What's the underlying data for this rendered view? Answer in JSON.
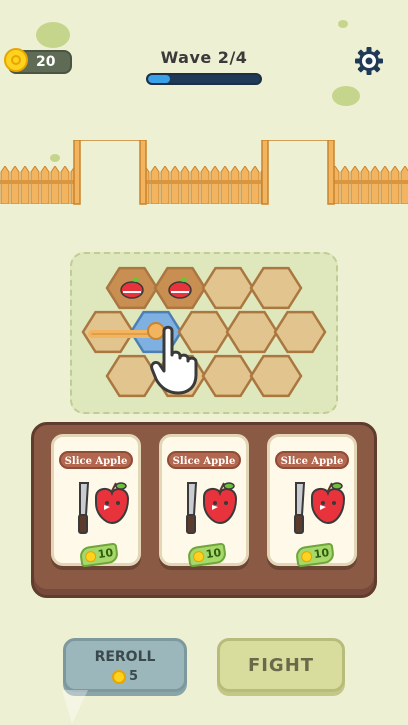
{
  "hud": {
    "coins": "20",
    "wave_label": "Wave 2/4",
    "wave_progress": 0.2
  },
  "icons": {
    "coin": "coin-icon",
    "settings": "gear-icon",
    "tutorial_hand": "pointing-hand-icon",
    "apple": "apple-icon",
    "knife": "knife-icon"
  },
  "board": {
    "grid_rows": 3,
    "occupied_slots": [
      "apple",
      "apple"
    ],
    "highlighted_slot": "row-2-col-2"
  },
  "shop": {
    "cards": [
      {
        "label": "Slice Apple",
        "price": "10"
      },
      {
        "label": "Slice Apple",
        "price": "10"
      },
      {
        "label": "Slice Apple",
        "price": "10"
      }
    ]
  },
  "buttons": {
    "reroll_label": "REROLL",
    "reroll_cost": "5",
    "fight_label": "FIGHT"
  },
  "colors": {
    "background": "#eef0d3",
    "wood": "#8a5a45",
    "hex_tile": "#e2c48f",
    "hex_highlight": "#7fb0e2",
    "accent_blue": "#3aa0e8"
  }
}
